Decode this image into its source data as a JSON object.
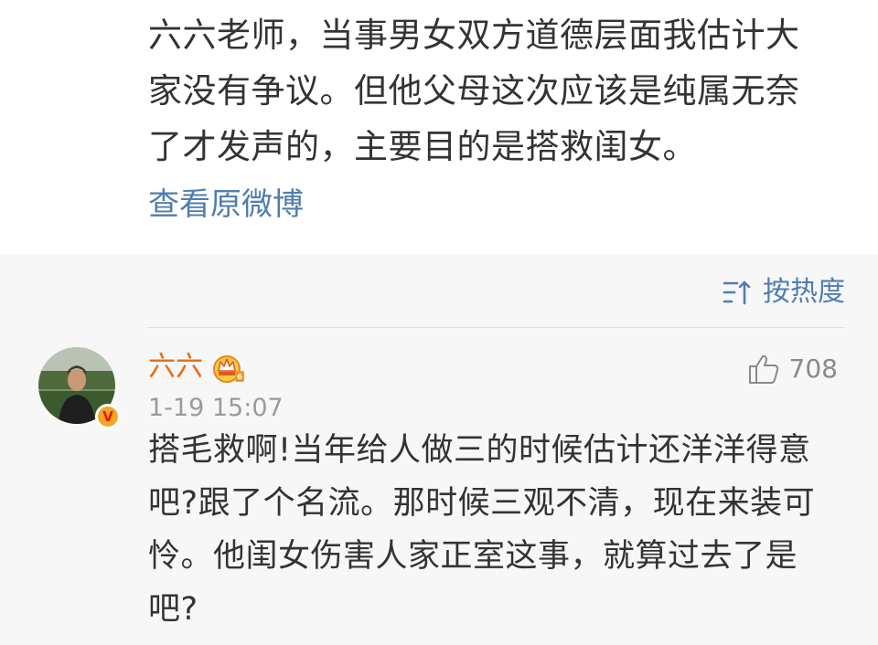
{
  "post": {
    "text": "六六老师，当事男女双方道德层面我估计大家没有争议。但他父母这次应该是纯属无奈了才发声的，主要目的是搭救闺女。",
    "view_original_label": "查看原微博"
  },
  "comments_header": {
    "sort_label": "按热度",
    "sort_icon": "sort-icon"
  },
  "comment": {
    "author": "六六",
    "author_badge_icon": "crown-icon",
    "verified_badge": "V",
    "time": "1-19 15:07",
    "like_icon": "thumbs-up-icon",
    "like_count": "708",
    "text": "搭毛救啊!当年给人做三的时候估计还洋洋得意吧?跟了个名流。那时候三观不清，现在来装可怜。他闺女伤害人家正室这事，就算过去了是吧?"
  },
  "colors": {
    "link": "#507daf",
    "author": "#e86b0f",
    "text": "#333333",
    "muted": "#9a9a9a",
    "comment_bg": "#f7f7f7"
  }
}
